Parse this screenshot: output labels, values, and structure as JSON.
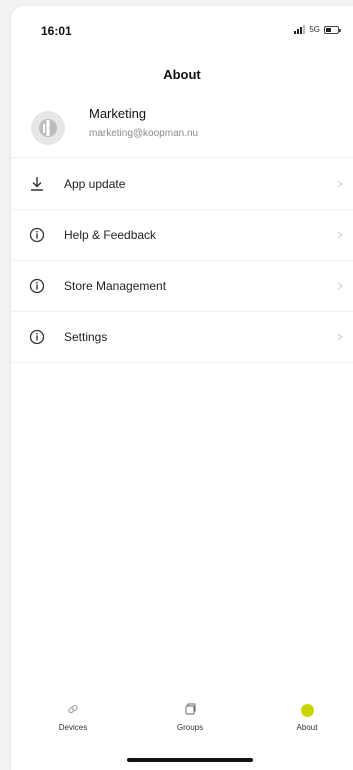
{
  "status_bar": {
    "time": "16:01",
    "network": "5G"
  },
  "header": {
    "title": "About"
  },
  "profile": {
    "name": "Marketing",
    "email": "marketing@koopman.nu"
  },
  "menu": {
    "items": [
      {
        "label": "App update",
        "icon": "download-icon"
      },
      {
        "label": "Help & Feedback",
        "icon": "info-icon"
      },
      {
        "label": "Store Management",
        "icon": "info-icon"
      },
      {
        "label": "Settings",
        "icon": "info-icon"
      }
    ]
  },
  "tabbar": {
    "tabs": [
      {
        "label": "Devices",
        "icon": "link-icon"
      },
      {
        "label": "Groups",
        "icon": "groups-icon"
      },
      {
        "label": "About",
        "icon": "active-dot"
      }
    ],
    "active_color": "#c8d400"
  }
}
